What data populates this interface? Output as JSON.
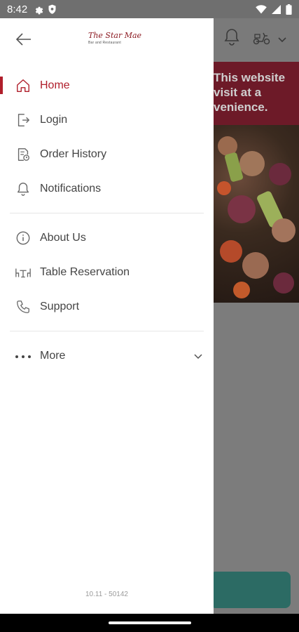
{
  "status_bar": {
    "time": "8:42",
    "left_icons": [
      "gear-icon",
      "shield-icon"
    ],
    "right_icons": [
      "wifi-icon",
      "signal-icon",
      "battery-icon"
    ]
  },
  "background_app": {
    "banner_lines": [
      "This website",
      "visit at a",
      "venience."
    ],
    "header_icons": [
      "bell-icon",
      "scooter-icon",
      "chevron-down-icon"
    ]
  },
  "drawer": {
    "brand": {
      "script": "The Star Mae",
      "subtitle": "Bar and Restaurant"
    },
    "primary_items": [
      {
        "label": "Home",
        "icon": "home-icon",
        "active": true
      },
      {
        "label": "Login",
        "icon": "login-icon",
        "active": false
      },
      {
        "label": "Order History",
        "icon": "order-history-icon",
        "active": false
      },
      {
        "label": "Notifications",
        "icon": "bell-icon",
        "active": false
      }
    ],
    "secondary_items": [
      {
        "label": "About Us",
        "icon": "info-icon"
      },
      {
        "label": "Table Reservation",
        "icon": "table-icon"
      },
      {
        "label": "Support",
        "icon": "phone-icon"
      }
    ],
    "more": {
      "label": "More",
      "icon": "dots-icon"
    },
    "version": "10.11 - 50142"
  },
  "colors": {
    "accent": "#b01e2b",
    "text": "#444444",
    "scrim": "#7c7c7c",
    "banner": "#6d1a28",
    "cta": "#2c6b64"
  }
}
